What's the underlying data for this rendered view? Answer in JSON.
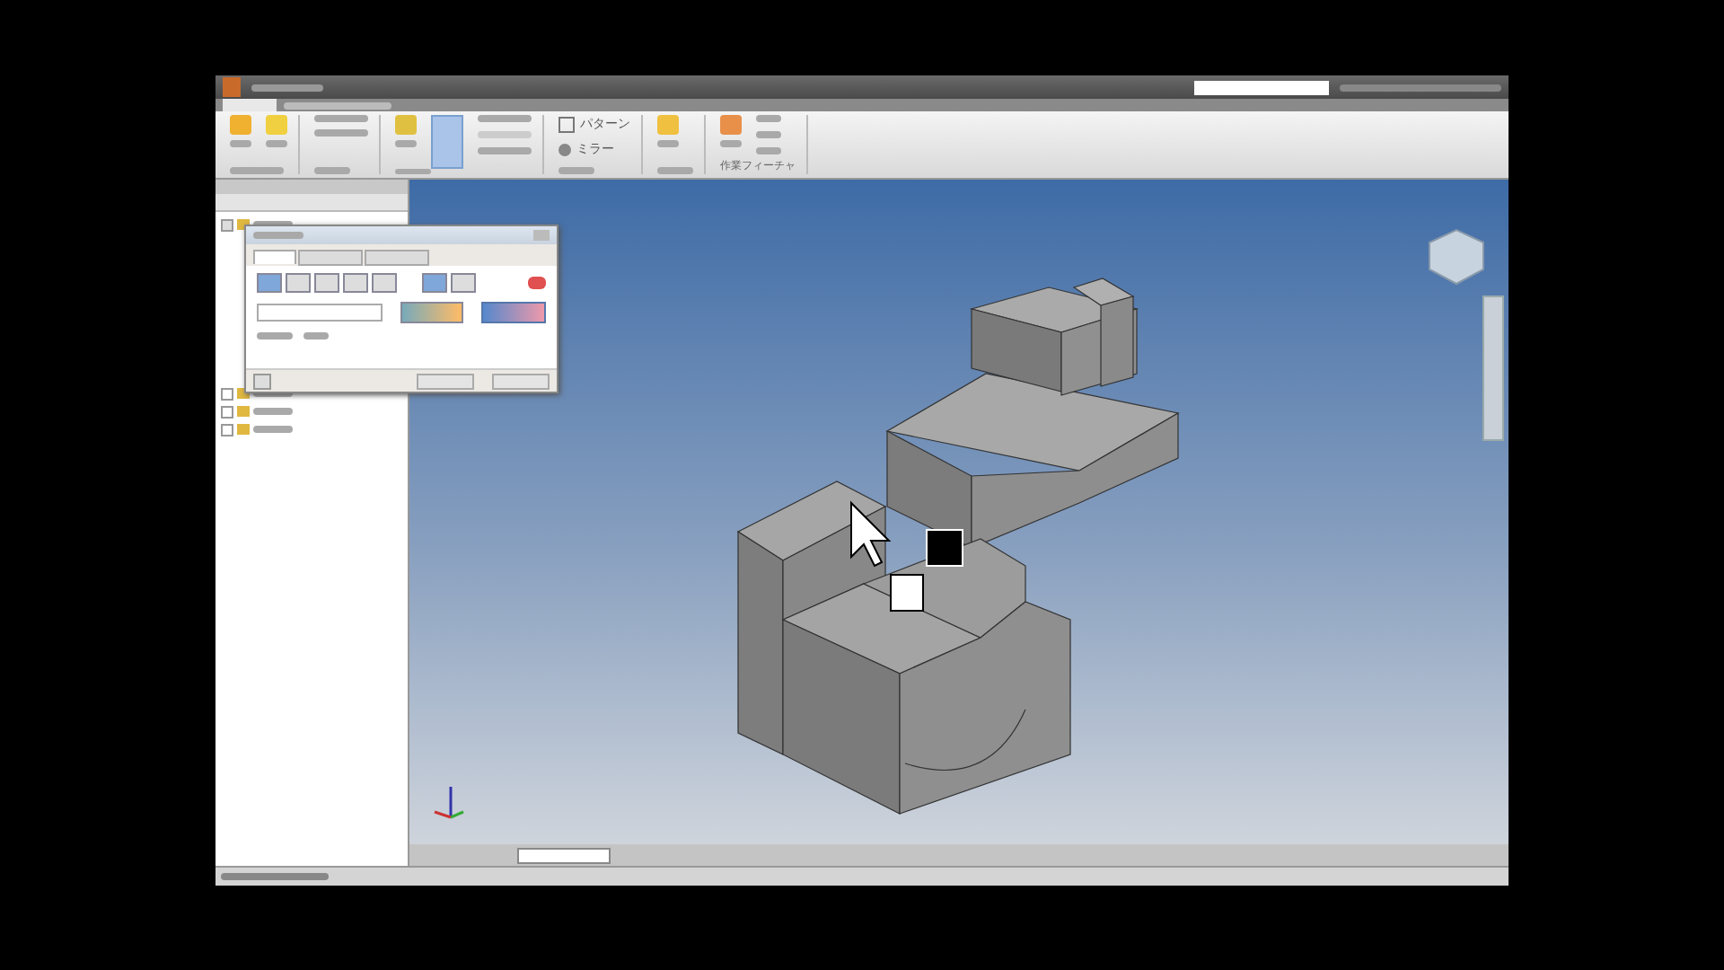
{
  "ribbon": {
    "tools": [
      {
        "label": "パターン",
        "kind": "small"
      },
      {
        "label": "ミラー",
        "kind": "small"
      }
    ],
    "panel_labels": [
      "作業フィーチャ"
    ]
  },
  "browser": {
    "tree": [
      {
        "expanded": true
      },
      {
        "expanded": false
      },
      {
        "expanded": false
      },
      {
        "expanded": false
      }
    ]
  },
  "dialog": {
    "tabs": [
      {
        "selected": true
      },
      {
        "selected": false
      },
      {
        "selected": false
      }
    ]
  }
}
